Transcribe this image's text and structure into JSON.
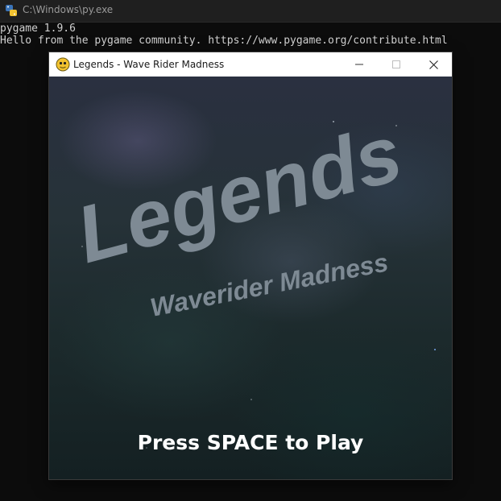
{
  "console": {
    "title": "C:\\Windows\\py.exe",
    "lines": [
      "pygame 1.9.6",
      "Hello from the pygame community. https://www.pygame.org/contribute.html"
    ]
  },
  "game_window": {
    "title": "Legends - Wave Rider Madness",
    "logo_title": "Legends",
    "logo_subtitle": "Waverider Madness",
    "prompt": "Press SPACE to Play"
  },
  "colors": {
    "logo_text": "#7e8a94",
    "prompt_text": "#ffffff",
    "titlebar_bg": "#ffffff",
    "console_bg": "#0c0c0c"
  },
  "icons": {
    "console": "python-icon",
    "game": "pygame-snake-icon",
    "minimize": "minimize-icon",
    "maximize": "maximize-icon",
    "close": "close-icon"
  }
}
